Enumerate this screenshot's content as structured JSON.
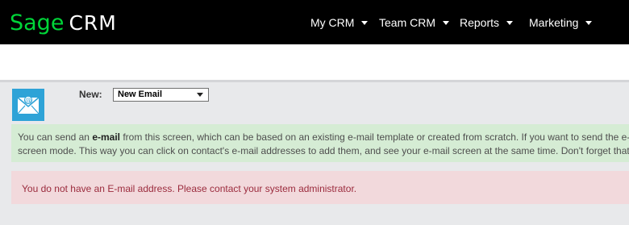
{
  "brand": {
    "logo_word": "Sage",
    "product": "CRM",
    "accent_color": "#00d639"
  },
  "nav": {
    "items": [
      {
        "label": "My CRM",
        "icon": "chevron-down-icon"
      },
      {
        "label": "Team CRM",
        "icon": "chevron-down-icon"
      },
      {
        "label": "Reports",
        "icon": "chevron-down-icon"
      },
      {
        "label": "Marketing",
        "icon": "chevron-down-icon"
      }
    ]
  },
  "toolbar": {
    "icon": "email-envelope-icon",
    "new_label": "New:",
    "new_select_value": "New Email"
  },
  "info": {
    "text_before": "You can send an ",
    "text_bold": "e-mail",
    "text_line1_after": " from this screen, which can be based on an existing e-mail template or created from scratch. If you want to send the e-mail",
    "text_line2": "screen mode. This way you can click on contact's e-mail addresses to add them, and see your e-mail screen at the same time. Don't forget that you",
    "background_color": "#d5ecd4"
  },
  "error": {
    "text": "You do not have an E-mail address. Please contact your system administrator.",
    "background_color": "#f2d9dc",
    "text_color": "#9b2b3d"
  }
}
